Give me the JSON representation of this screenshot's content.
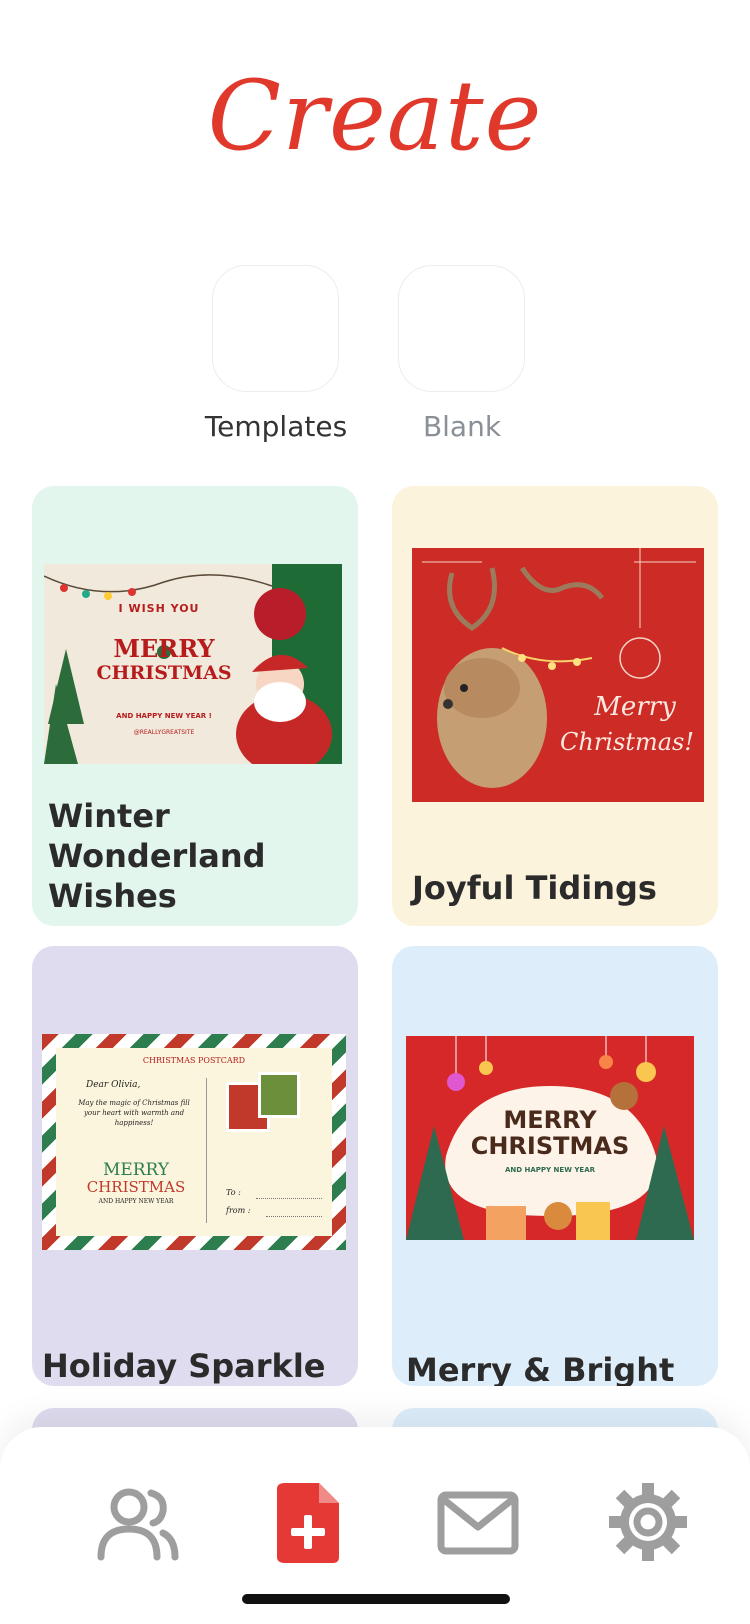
{
  "header": {
    "title": "Create"
  },
  "modes": [
    {
      "label": "Templates",
      "color": "#333333"
    },
    {
      "label": "Blank",
      "color": "#8a8f98"
    }
  ],
  "cards": [
    {
      "title": "Winter Wonderland Wishes",
      "bg": "#e2f6ee",
      "preview": {
        "line1": "I WISH YOU",
        "line2": "MERRY",
        "line3": "CHRISTMAS",
        "line4": "AND HAPPY NEW YEAR !",
        "line5": "@REALLYGREATSITE"
      }
    },
    {
      "title": "Joyful Tidings",
      "bg": "#fbf3dc",
      "preview": {
        "line1": "Merry",
        "line2": "Christmas!"
      }
    },
    {
      "title": "Holiday Sparkle",
      "bg": "#dedcee",
      "preview": {
        "heading": "CHRISTMAS POSTCARD",
        "greeting": "Dear Olivia,",
        "message": "May the magic of Christmas fill your heart with warmth and happiness!",
        "line1": "MERRY",
        "line2": "CHRISTMAS",
        "line3": "AND HAPPY NEW YEAR",
        "to": "To :",
        "from": "from :"
      }
    },
    {
      "title": "Merry & Bright",
      "bg": "#ddeefa",
      "preview": {
        "line1": "MERRY",
        "line2": "CHRISTMAS",
        "line3": "AND HAPPY NEW YEAR"
      }
    }
  ],
  "nav": {
    "items": [
      {
        "icon": "users-icon",
        "color": "#9e9e9e"
      },
      {
        "icon": "file-plus-icon",
        "color": "#e53935"
      },
      {
        "icon": "mail-icon",
        "color": "#9e9e9e"
      },
      {
        "icon": "settings-icon",
        "color": "#9e9e9e"
      }
    ]
  },
  "colors": {
    "accent": "#e0392b"
  }
}
